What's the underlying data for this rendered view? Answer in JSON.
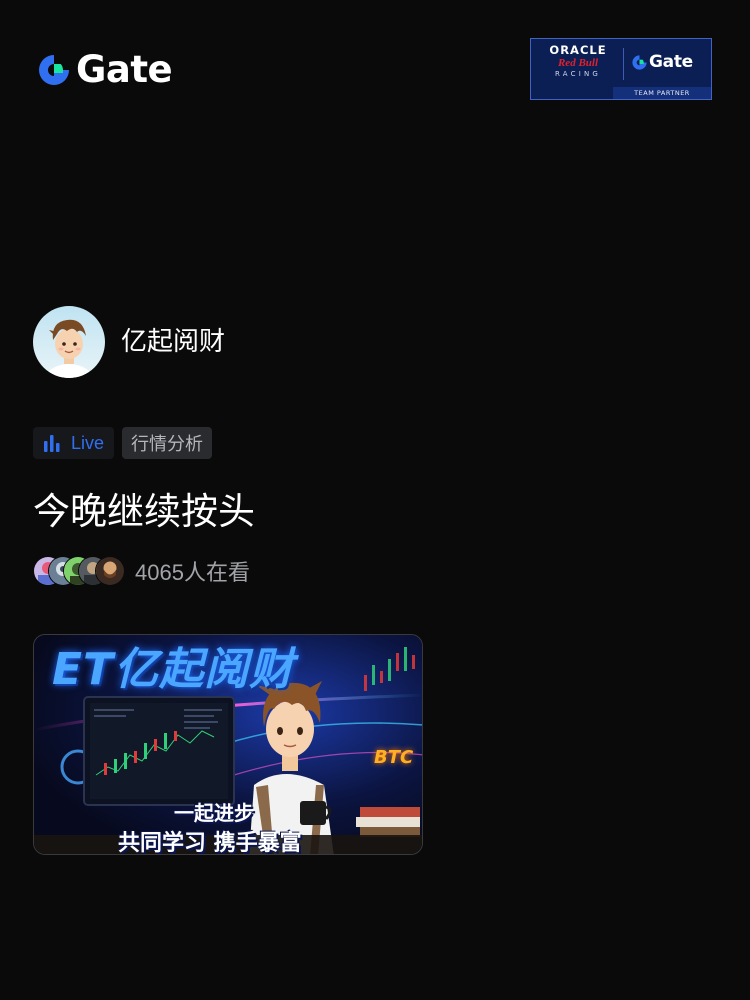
{
  "header": {
    "brand_name": "Gate",
    "partner": {
      "oracle": "ORACLE",
      "redbull": "Red Bull",
      "racing": "RACING",
      "gate": "Gate",
      "tag": "TEAM PARTNER"
    }
  },
  "streamer": {
    "name": "亿起阅财",
    "avatar_icon": "avatar-illustration"
  },
  "tags": {
    "live_label": "Live",
    "live_icon": "bar-chart-icon",
    "category": "行情分析"
  },
  "stream": {
    "title": "今晚继续按头"
  },
  "viewers": {
    "count_text": "4065人在看",
    "avatar_count": 5
  },
  "thumbnail": {
    "headline": "ET亿起阅财",
    "btc": "BTC",
    "line1": "一起进步",
    "line2": "共同学习 携手暴富"
  },
  "colors": {
    "background": "#0a0a0a",
    "brand_blue": "#2f6ff0",
    "brand_green": "#17e5a0",
    "live_blue": "#2f6ff0"
  }
}
